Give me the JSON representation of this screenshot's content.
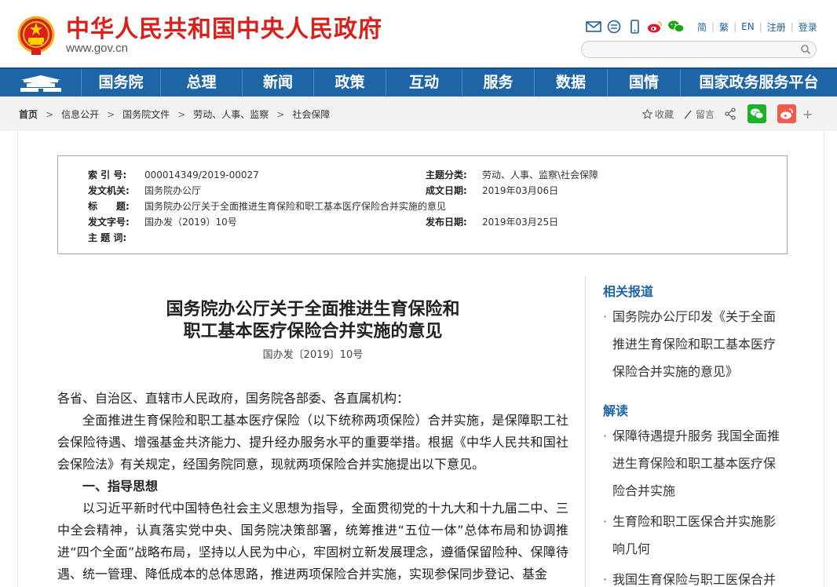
{
  "header": {
    "site_title": "中华人民共和国中央人民政府",
    "site_url": "www.gov.cn",
    "lang": [
      "简",
      "繁",
      "EN",
      "注册",
      "登录"
    ],
    "search_placeholder": ""
  },
  "nav": {
    "items": [
      "国务院",
      "总理",
      "新闻",
      "政策",
      "互动",
      "服务",
      "数据",
      "国情",
      "国家政务服务平台"
    ]
  },
  "breadcrumb": {
    "items": [
      "首页",
      "信息公开",
      "国务院文件",
      "劳动、人事、监察",
      "社会保障"
    ]
  },
  "share": {
    "favorite_label": "收藏",
    "comment_label": "留言",
    "plus_label": "+"
  },
  "meta": {
    "index_label": "索 引 号:",
    "index_value": "000014349/2019-00027",
    "category_label": "主题分类:",
    "category_value": "劳动、人事、监察\\社会保障",
    "issuer_label": "发文机关:",
    "issuer_value": "国务院办公厅",
    "created_label": "成文日期:",
    "created_value": "2019年03月06日",
    "title_label": "标　　题:",
    "title_value": "国务院办公厅关于全面推进生育保险和职工基本医疗保险合并实施的意见",
    "docnum_label": "发文字号:",
    "docnum_value": "国办发（2019）10号",
    "published_label": "发布日期:",
    "published_value": "2019年03月25日",
    "keywords_label": "主 题 词:",
    "keywords_value": ""
  },
  "article": {
    "title_line1": "国务院办公厅关于全面推进生育保险和",
    "title_line2": "职工基本医疗保险合并实施的意见",
    "doc_number": "国办发〔2019〕10号",
    "salutation": "各省、自治区、直辖市人民政府，国务院各部委、各直属机构：",
    "para1": "全面推进生育保险和职工基本医疗保险（以下统称两项保险）合并实施，是保障职工社会保险待遇、增强基金共济能力、提升经办服务水平的重要举措。根据《中华人民共和国社会保险法》有关规定，经国务院同意，现就两项保险合并实施提出以下意见。",
    "heading1": "一、指导思想",
    "para2": "以习近平新时代中国特色社会主义思想为指导，全面贯彻党的十九大和十九届二中、三中全会精神，认真落实党中央、国务院决策部署，统筹推进“五位一体”总体布局和协调推进“四个全面”战略布局，坚持以人民为中心，牢固树立新发展理念，遵循保留险种、保障待遇、统一管理、降低成本的总体思路，推进两项保险合并实施，实现参保同步登记、基金"
  },
  "sidebar": {
    "related_heading": "相关报道",
    "related_items": [
      "国务院办公厅印发《关于全面推进生育保险和职工基本医疗保险合并实施的意见》"
    ],
    "interpret_heading": "解读",
    "interpret_items": [
      "保障待遇提升服务 我国全面推进生育保险和职工基本医疗保险合并实施",
      "生育险和职工医保合并实施影响几何",
      "我国生育保险与职工医保合并"
    ]
  },
  "colors": {
    "brand_red": "#d8201c",
    "nav_blue": "#1d65a6",
    "link_blue": "#1d5e9e"
  }
}
